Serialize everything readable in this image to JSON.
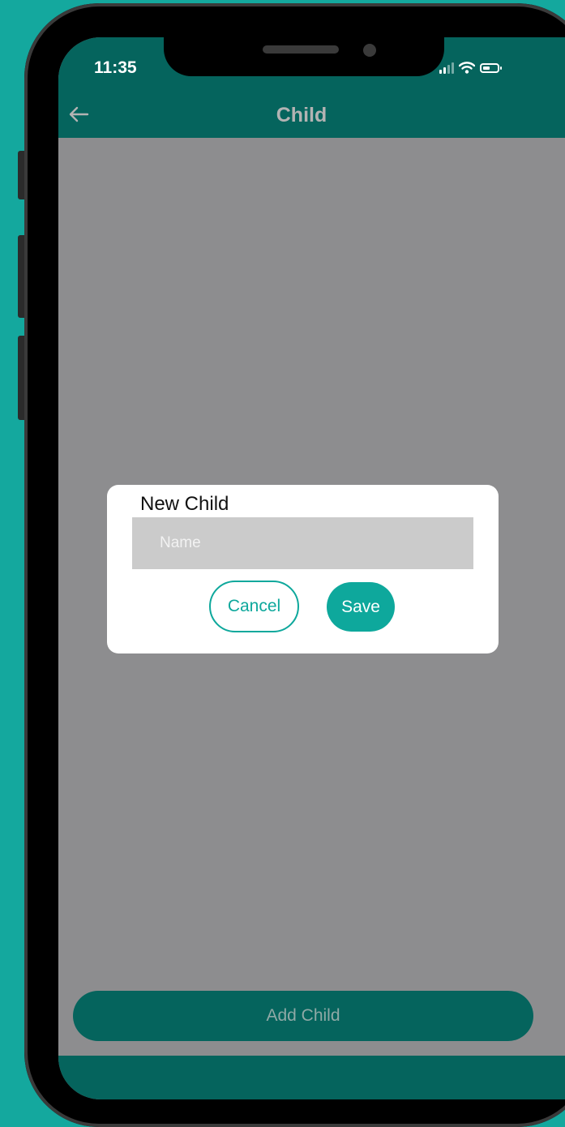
{
  "status_bar": {
    "time": "11:35",
    "signal_icon": "cellular-signal-icon",
    "wifi_icon": "wifi-icon",
    "battery_icon": "battery-icon"
  },
  "header": {
    "title": "Child",
    "back_icon": "arrow-left-icon"
  },
  "dialog": {
    "title": "New Child",
    "name_input": {
      "placeholder": "Name",
      "value": ""
    },
    "cancel_label": "Cancel",
    "save_label": "Save"
  },
  "footer": {
    "add_child_label": "Add Child"
  },
  "colors": {
    "background": "#14a89e",
    "header": "#05645d",
    "accent": "#0ea89c",
    "overlay": "#8d8d8f"
  }
}
